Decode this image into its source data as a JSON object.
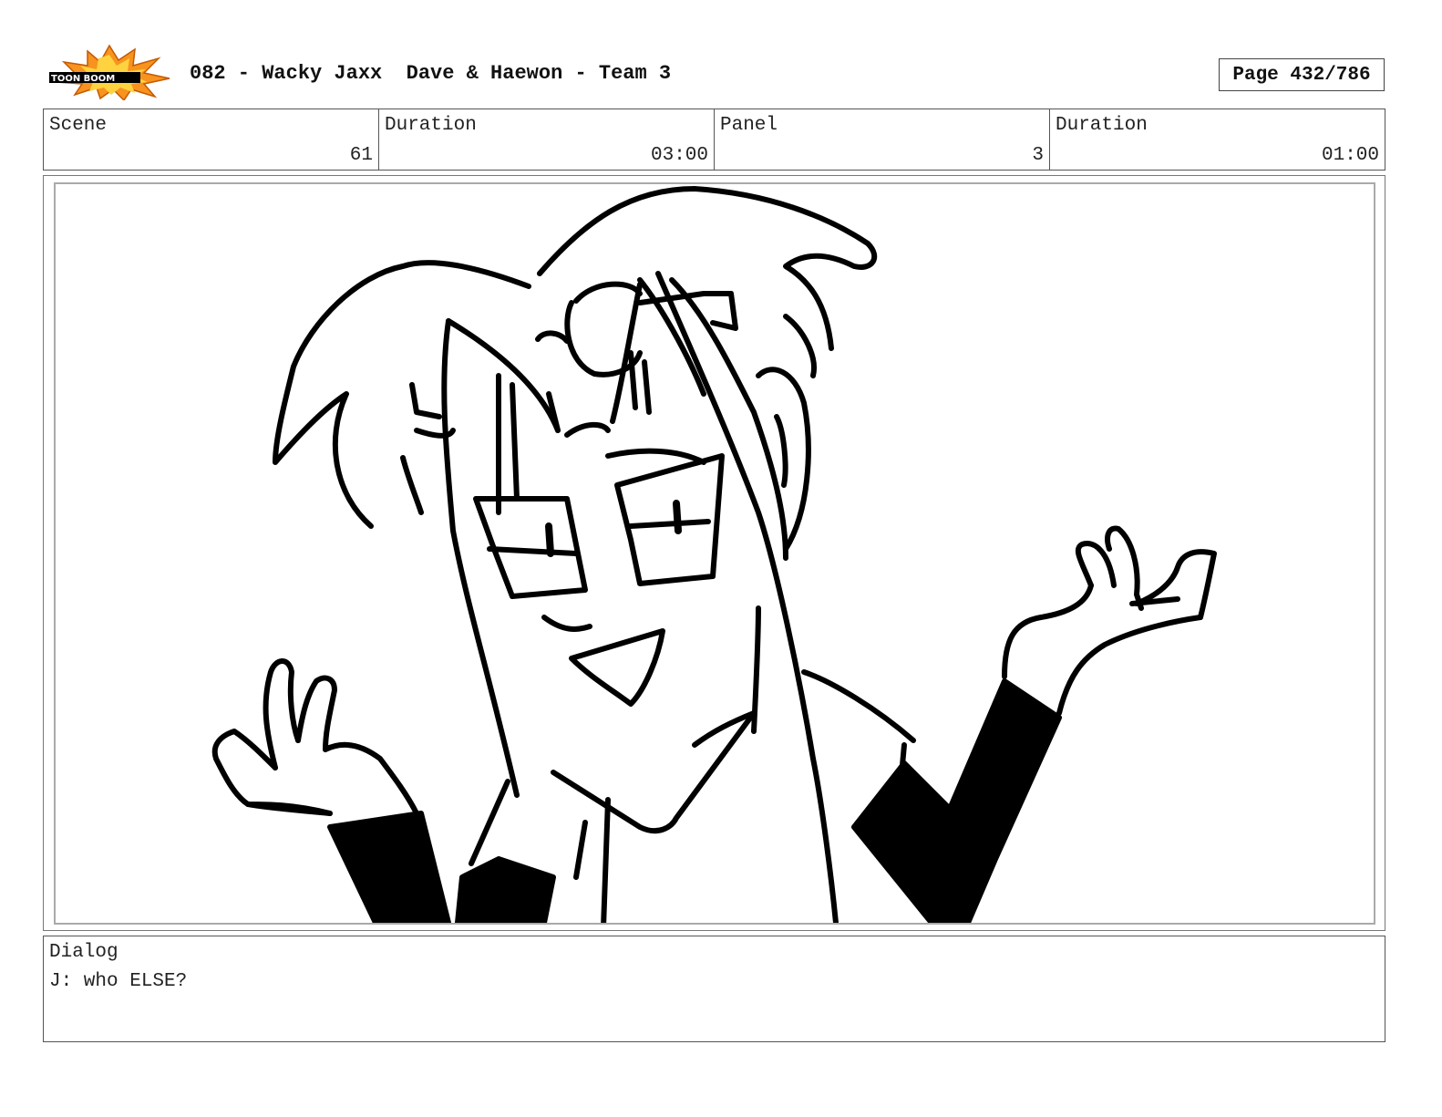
{
  "header": {
    "logo_text": "TOON BOOM",
    "title": "082 - Wacky Jaxx  Dave & Haewon - Team 3",
    "page": "Page 432/786"
  },
  "info": {
    "scene_label": "Scene",
    "scene_value": "61",
    "scene_duration_label": "Duration",
    "scene_duration_value": "03:00",
    "panel_label": "Panel",
    "panel_value": "3",
    "panel_duration_label": "Duration",
    "panel_duration_value": "01:00"
  },
  "dialog": {
    "label": "Dialog",
    "text": "J: who ELSE?"
  },
  "colors": {
    "logo_burst": "#f7931e",
    "ink": "#000000"
  }
}
